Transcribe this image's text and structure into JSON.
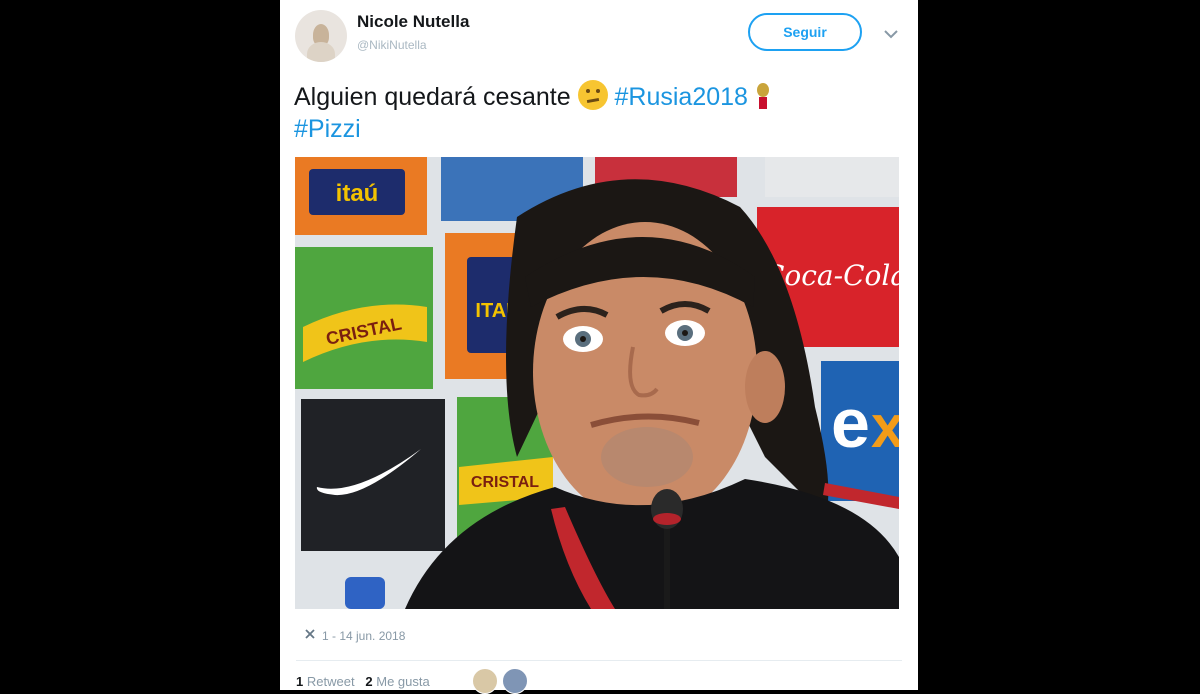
{
  "tweet": {
    "author_name": "Nicole Nutella",
    "author_handle": "@NikiNutella",
    "follow_label": "Seguir",
    "text": "Alguien quedará cesante",
    "hashtags": [
      "#Rusia2018",
      "#Pizzi"
    ],
    "timestamp": "1 - 14 jun. 2018",
    "retweet_count": "1",
    "retweet_label": "Retweet",
    "like_count": "2",
    "like_label": "Me gusta"
  },
  "photo": {
    "sponsor_labels": [
      "itaú",
      "CRISTAL",
      "Coca-Cola",
      "ITAÚ",
      "CRISTAL"
    ]
  },
  "colors": {
    "accent": "#1da1f2",
    "hashtag": "#1b95e0",
    "background": "#000000"
  },
  "icons": [
    "thinking-face-icon",
    "world-cup-trophy-icon",
    "chevron-down-icon",
    "close-icon"
  ]
}
